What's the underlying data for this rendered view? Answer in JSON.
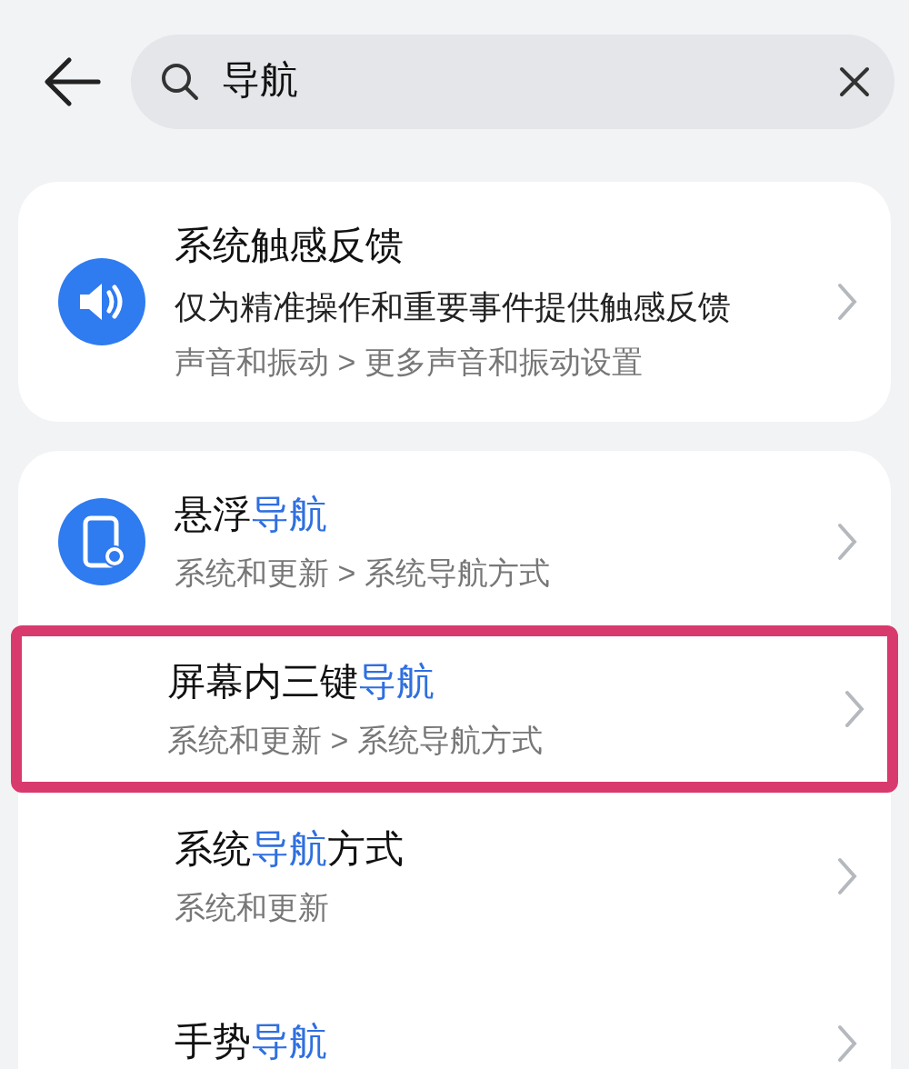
{
  "search": {
    "value": "导航"
  },
  "cards": [
    {
      "items": [
        {
          "kind": "sound",
          "title": [
            {
              "text": "系统触感反馈",
              "match": false
            }
          ],
          "description": "仅为精准操作和重要事件提供触感反馈",
          "path": "声音和振动 > 更多声音和振动设置",
          "highlighted": false
        }
      ]
    },
    {
      "items": [
        {
          "kind": "device",
          "title": [
            {
              "text": "悬浮",
              "match": false
            },
            {
              "text": "导航",
              "match": true
            }
          ],
          "path": "系统和更新 > 系统导航方式",
          "highlighted": false
        },
        {
          "kind": "plain",
          "title": [
            {
              "text": "屏幕内三键",
              "match": false
            },
            {
              "text": "导航",
              "match": true
            }
          ],
          "path": "系统和更新 > 系统导航方式",
          "highlighted": true
        },
        {
          "kind": "plain",
          "title": [
            {
              "text": "系统",
              "match": false
            },
            {
              "text": "导航",
              "match": true
            },
            {
              "text": "方式",
              "match": false
            }
          ],
          "path": "系统和更新",
          "highlighted": false
        },
        {
          "kind": "plain",
          "title": [
            {
              "text": "手势",
              "match": false
            },
            {
              "text": "导航",
              "match": true
            }
          ],
          "highlighted": false
        }
      ]
    }
  ]
}
